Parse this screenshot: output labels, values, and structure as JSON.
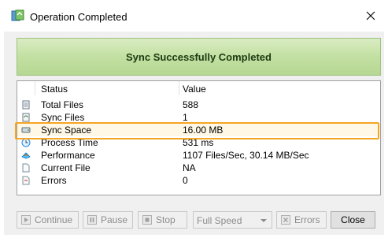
{
  "window": {
    "title": "Operation Completed",
    "close_symbol": "×"
  },
  "banner": {
    "text": "Sync Successfully Completed"
  },
  "grid": {
    "columns": [
      "Status",
      "Value"
    ],
    "rows": [
      {
        "name": "Total Files",
        "value": "588",
        "icon": "files-icon"
      },
      {
        "name": "Sync Files",
        "value": "1",
        "icon": "sync-files-icon"
      },
      {
        "name": "Sync Space",
        "value": "16.00 MB",
        "icon": "disk-space-icon"
      },
      {
        "name": "Process Time",
        "value": "531 ms",
        "icon": "clock-icon"
      },
      {
        "name": "Performance",
        "value": "1107 Files/Sec, 30.14 MB/Sec",
        "icon": "performance-icon"
      },
      {
        "name": "Current File",
        "value": "NA",
        "icon": "file-icon"
      },
      {
        "name": "Errors",
        "value": "0",
        "icon": "errors-icon"
      }
    ]
  },
  "toolbar": {
    "continue_label": "Continue",
    "pause_label": "Pause",
    "stop_label": "Stop",
    "speed_value": "Full Speed",
    "errors_label": "Errors",
    "close_label": "Close"
  },
  "colors": {
    "highlight_border": "#f5a623",
    "banner_green": "#c3e0a2"
  }
}
